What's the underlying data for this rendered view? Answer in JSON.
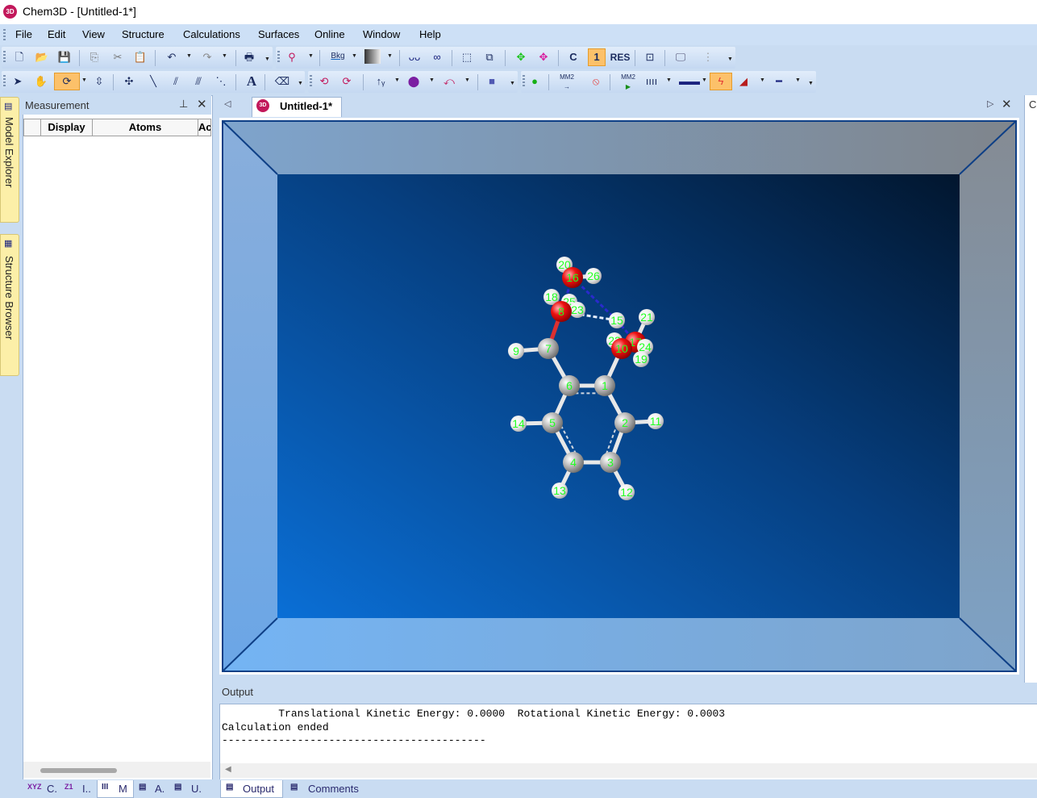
{
  "window": {
    "title": "Chem3D - [Untitled-1*]",
    "app_icon_text": "3D"
  },
  "menu": [
    "File",
    "Edit",
    "View",
    "Structure",
    "Calculations",
    "Surfaces",
    "Online",
    "Window",
    "Help"
  ],
  "toolbar": {
    "bkg_label": "Bkg",
    "carbon_label": "C",
    "serial_label": "1",
    "res_label": "RES",
    "mm2_label": "MM2",
    "text_tool": "A"
  },
  "side_tabs": {
    "model_explorer": "Model Explorer",
    "structure_browser": "Structure Browser"
  },
  "measurement": {
    "title": "Measurement",
    "columns": [
      "Display",
      "Atoms",
      "Ac"
    ]
  },
  "document": {
    "tab_label": "Untitled-1*"
  },
  "molecule": {
    "atoms": [
      {
        "id": "1",
        "type": "C"
      },
      {
        "id": "2",
        "type": "C"
      },
      {
        "id": "3",
        "type": "C"
      },
      {
        "id": "4",
        "type": "C"
      },
      {
        "id": "5",
        "type": "C"
      },
      {
        "id": "6",
        "type": "C"
      },
      {
        "id": "7",
        "type": "C"
      },
      {
        "id": "8",
        "type": "O"
      },
      {
        "id": "9",
        "type": "H"
      },
      {
        "id": "10",
        "type": "O"
      },
      {
        "id": "11",
        "type": "H"
      },
      {
        "id": "12",
        "type": "H"
      },
      {
        "id": "13",
        "type": "H"
      },
      {
        "id": "14",
        "type": "H"
      },
      {
        "id": "15",
        "type": "H"
      },
      {
        "id": "16",
        "type": "O"
      },
      {
        "id": "17",
        "type": "O"
      },
      {
        "id": "18",
        "type": "H"
      },
      {
        "id": "19",
        "type": "H"
      },
      {
        "id": "20",
        "type": "H"
      },
      {
        "id": "21",
        "type": "H"
      },
      {
        "id": "22",
        "type": "H"
      },
      {
        "id": "23",
        "type": "H"
      },
      {
        "id": "24",
        "type": "H"
      },
      {
        "id": "25",
        "type": "H"
      },
      {
        "id": "26",
        "type": "H"
      }
    ],
    "colors": {
      "carbon": "#b9b9b9",
      "oxygen": "#e01010",
      "hydrogen": "#f2f2f2",
      "label": "#22ff22",
      "hbond": "#2a2acc"
    }
  },
  "output": {
    "title": "Output",
    "lines": [
      "         Translational Kinetic Energy: 0.0000  Rotational Kinetic Energy: 0.0003",
      "Calculation ended",
      "------------------------------------------"
    ]
  },
  "bottom_tabs": {
    "left": [
      {
        "icon": "XYZ",
        "label": "C."
      },
      {
        "icon": "Z1",
        "label": "I.."
      },
      {
        "icon": "III",
        "label": "M"
      },
      {
        "icon": "▤",
        "label": "A."
      },
      {
        "icon": "▤",
        "label": "U."
      }
    ],
    "right": [
      {
        "icon": "▤",
        "label": "Output"
      },
      {
        "icon": "▤",
        "label": "Comments"
      }
    ]
  },
  "right_panel_stub": "C"
}
